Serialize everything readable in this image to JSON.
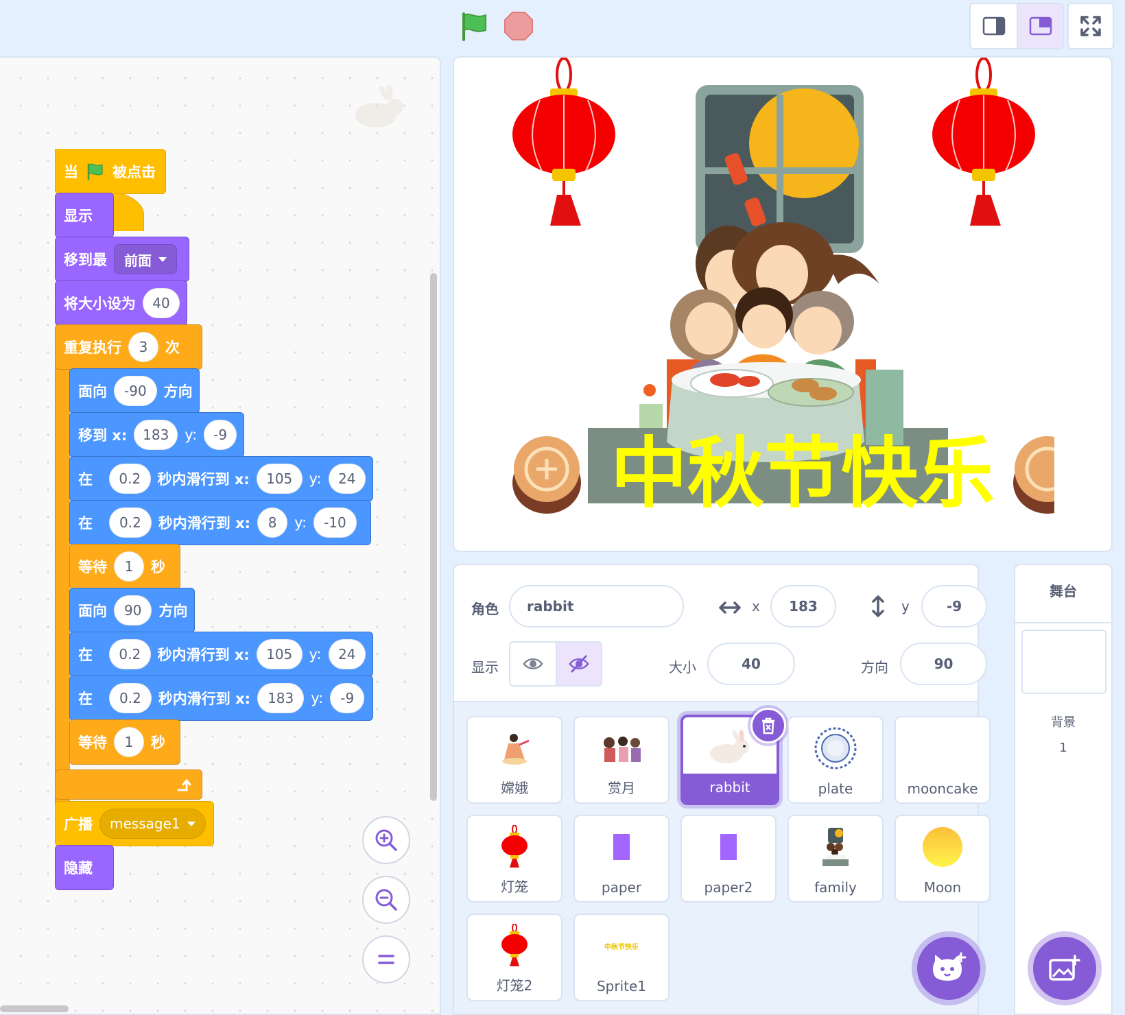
{
  "colors": {
    "accent": "#855cd6",
    "events": "#ffbf00",
    "looks": "#9966ff",
    "motion": "#4c97ff",
    "control": "#ffab19"
  },
  "toolbar": {
    "green_flag_icon": "green-flag-icon",
    "stop_icon": "stop-icon"
  },
  "scripts": {
    "when_flag": {
      "pre": "当",
      "post": "被点击"
    },
    "show": "显示",
    "go_to_layer": {
      "label": "移到最",
      "option": "前面"
    },
    "set_size": {
      "label": "将大小设为",
      "value": "40"
    },
    "repeat": {
      "label": "重复执行",
      "value": "3",
      "suffix": "次"
    },
    "point1": {
      "label": "面向",
      "value": "-90",
      "suffix": "方向"
    },
    "goto": {
      "label": "移到 x:",
      "x": "183",
      "ylabel": "y:",
      "y": "-9"
    },
    "glide1": {
      "in": "在",
      "secs": "0.2",
      "mid": "秒内滑行到 x:",
      "x": "105",
      "ylabel": "y:",
      "y": "24"
    },
    "glide2": {
      "in": "在",
      "secs": "0.2",
      "mid": "秒内滑行到 x:",
      "x": "8",
      "ylabel": "y:",
      "y": "-10"
    },
    "wait1": {
      "label": "等待",
      "value": "1",
      "suffix": "秒"
    },
    "point2": {
      "label": "面向",
      "value": "90",
      "suffix": "方向"
    },
    "glide3": {
      "in": "在",
      "secs": "0.2",
      "mid": "秒内滑行到 x:",
      "x": "105",
      "ylabel": "y:",
      "y": "24"
    },
    "glide4": {
      "in": "在",
      "secs": "0.2",
      "mid": "秒内滑行到 x:",
      "x": "183",
      "ylabel": "y:",
      "y": "-9"
    },
    "wait2": {
      "label": "等待",
      "value": "1",
      "suffix": "秒"
    },
    "broadcast": {
      "label": "广播",
      "option": "message1"
    },
    "hide": "隐藏"
  },
  "stage": {
    "banner": "中秋节快乐"
  },
  "sprite_info": {
    "sprite_label": "角色",
    "sprite_name": "rabbit",
    "x_label": "x",
    "x": "183",
    "y_label": "y",
    "y": "-9",
    "show_label": "显示",
    "size_label": "大小",
    "size": "40",
    "direction_label": "方向",
    "direction": "90"
  },
  "sprites": [
    {
      "name": "嫦娥",
      "icon": "change-icon"
    },
    {
      "name": "赏月",
      "icon": "moon-viewing-icon"
    },
    {
      "name": "rabbit",
      "icon": "rabbit-icon",
      "selected": true
    },
    {
      "name": "plate",
      "icon": "plate-icon"
    },
    {
      "name": "mooncake",
      "icon": "mooncake-icon"
    },
    {
      "name": "灯笼",
      "icon": "lantern-icon"
    },
    {
      "name": "paper",
      "icon": "paper-icon"
    },
    {
      "name": "paper2",
      "icon": "paper-icon"
    },
    {
      "name": "family",
      "icon": "family-icon"
    },
    {
      "name": "Moon",
      "icon": "moon-icon"
    },
    {
      "name": "灯笼2",
      "icon": "lantern-icon"
    },
    {
      "name": "Sprite1",
      "icon": "text-sprite-icon",
      "thumb_text": "中秋节快乐"
    }
  ],
  "stage_pane": {
    "title": "舞台",
    "backdrop_label": "背景",
    "backdrop_count": "1"
  }
}
